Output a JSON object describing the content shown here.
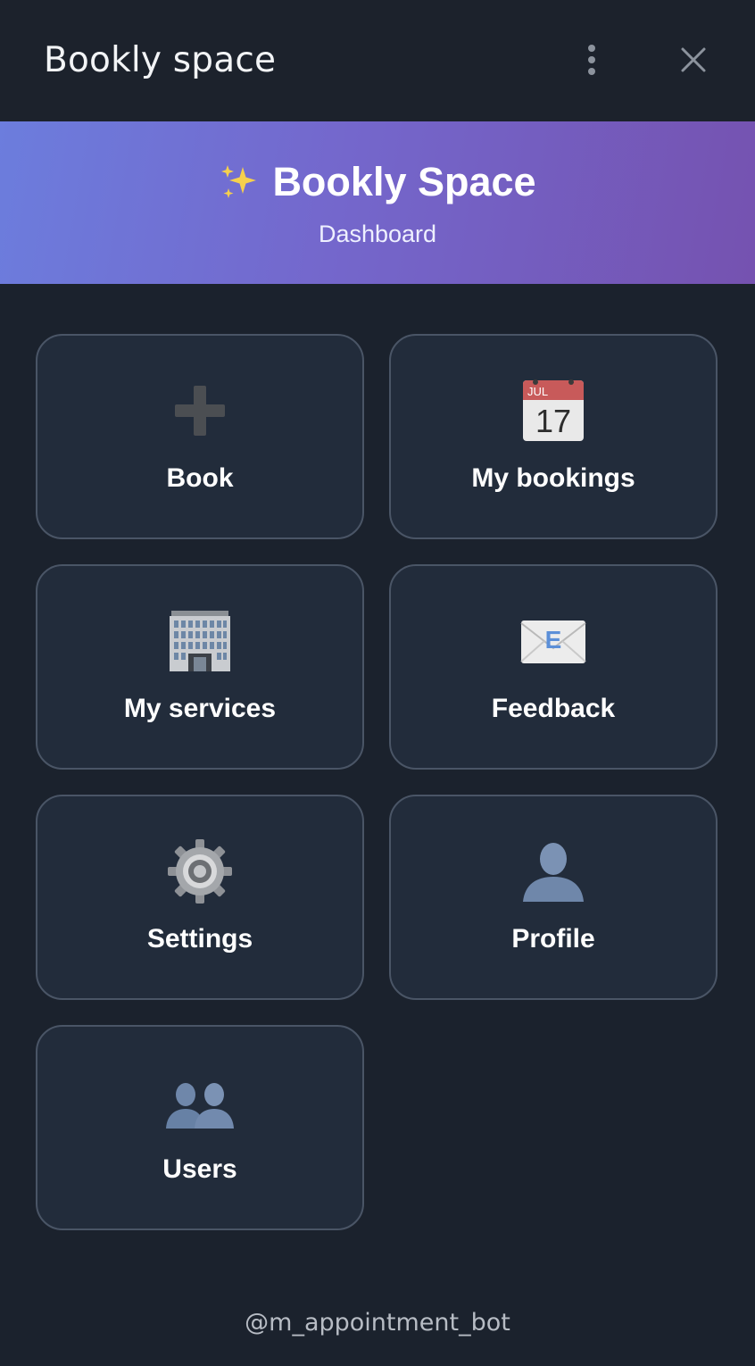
{
  "header": {
    "title": "Bookly space",
    "more_icon": "more-vertical-icon",
    "close_icon": "close-icon"
  },
  "banner": {
    "icon": "sparkles-icon",
    "title": "Bookly Space",
    "subtitle": "Dashboard",
    "gradient_start": "#6c7ddd",
    "gradient_end": "#7552b0"
  },
  "menu": {
    "items": [
      {
        "label": "Book",
        "icon": "plus-icon"
      },
      {
        "label": "My bookings",
        "icon": "calendar-icon",
        "icon_month": "JUL",
        "icon_day": "17"
      },
      {
        "label": "My services",
        "icon": "office-building-icon"
      },
      {
        "label": "Feedback",
        "icon": "envelope-icon",
        "icon_letter": "E"
      },
      {
        "label": "Settings",
        "icon": "gear-icon"
      },
      {
        "label": "Profile",
        "icon": "user-silhouette-icon"
      },
      {
        "label": "Users",
        "icon": "users-silhouette-icon"
      }
    ]
  },
  "footer": {
    "bot_handle": "@m_appointment_bot"
  },
  "colors": {
    "background": "#1b222d",
    "tile_background": "#222c3b",
    "tile_border": "#4a5566"
  }
}
